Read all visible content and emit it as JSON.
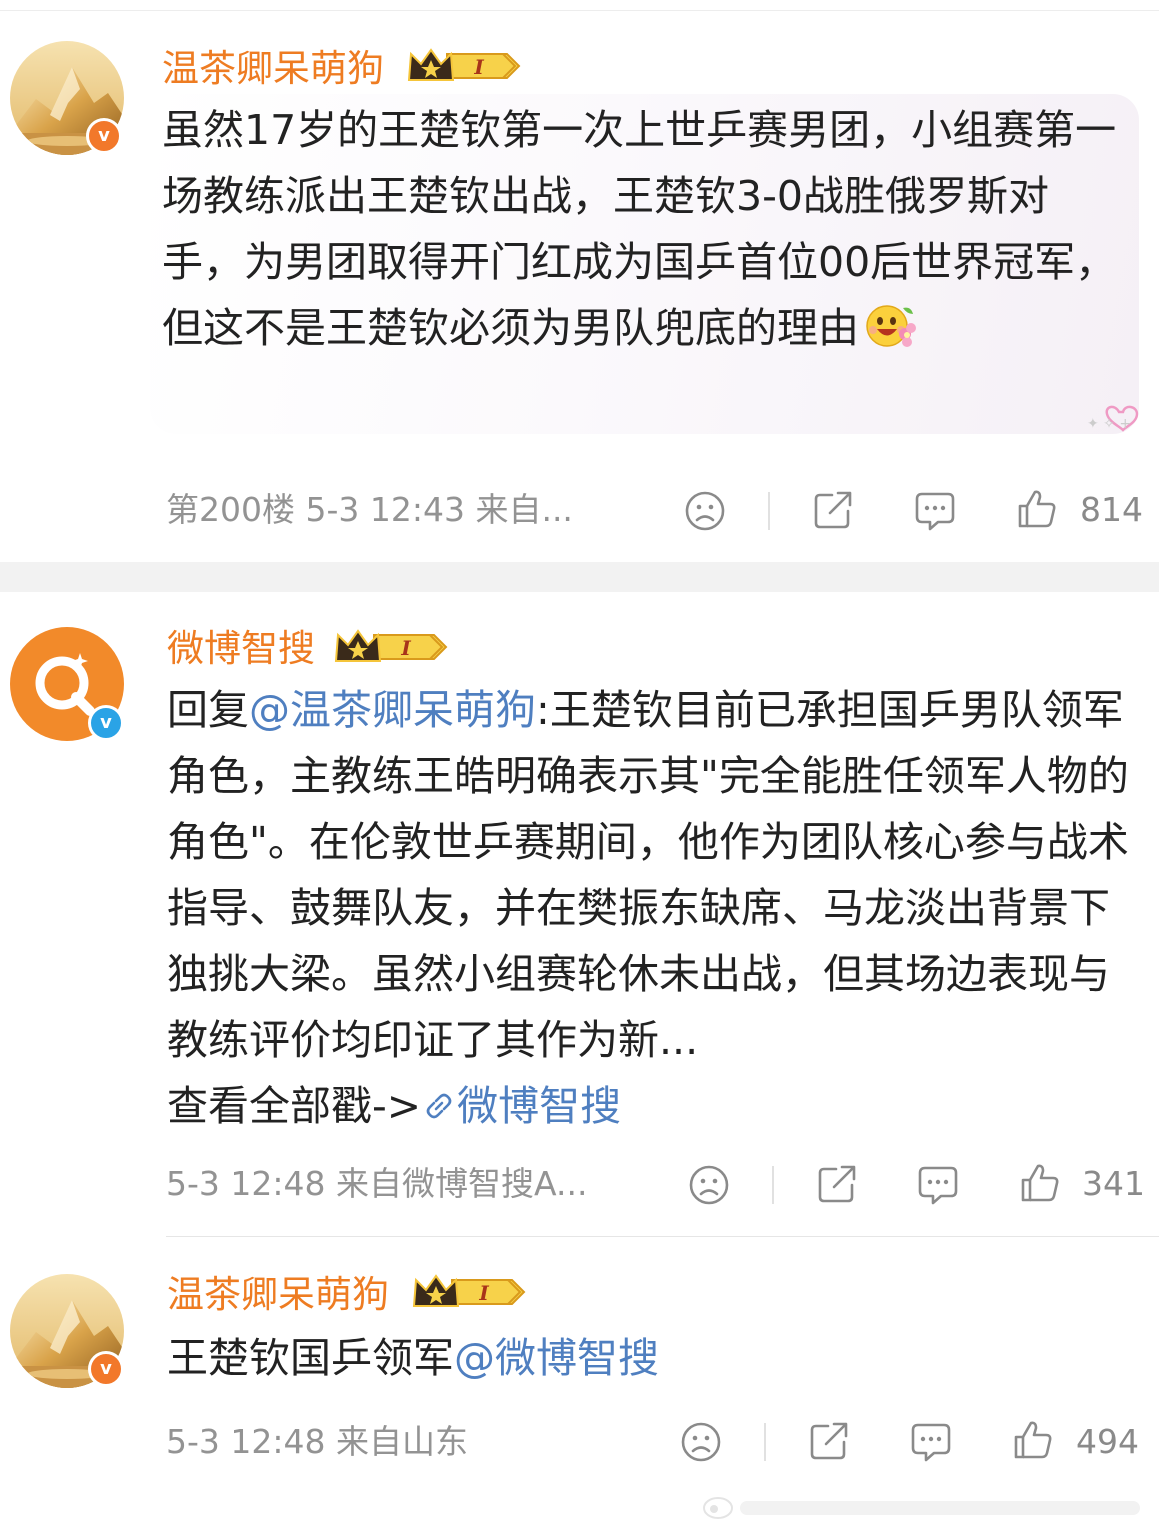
{
  "comments": [
    {
      "username": "温茶卿呆萌狗",
      "level": "I",
      "text": "虽然17岁的王楚钦第一次上世乒赛男团，小组赛第一场教练派出王楚钦出战，王楚钦3-0战胜俄罗斯对手，为男团取得开门红成为国乒首位00后世界冠军，但这不是王楚钦必须为男队兜底的理由",
      "meta": "第200楼  5-3 12:43  来自...",
      "likes": "814"
    },
    {
      "username": "微博智搜",
      "level": "I",
      "reply_prefix": "回复",
      "reply_mention": "@温茶卿呆萌狗",
      "reply_text": ":王楚钦目前已承担国乒男队领军角色，主教练王皓明确表示其\"完全能胜任领军人物的角色\"。在伦敦世乒赛期间，他作为团队核心参与战术指导、鼓舞队友，并在樊振东缺席、马龙淡出背景下独挑大梁。虽然小组赛轮休未出战，但其场边表现与教练评价均印证了其作为新...",
      "view_all": "查看全部戳->",
      "view_all_link": "微博智搜",
      "meta": "5-3 12:48  来自微博智搜A...",
      "likes": "341"
    },
    {
      "username": "温茶卿呆萌狗",
      "level": "I",
      "text": "王楚钦国乒领军",
      "mention": "@微博智搜",
      "meta": "5-3 12:48  来自山东",
      "likes": "494"
    }
  ],
  "icons": {
    "dislike": "frown-face-icon",
    "share": "share-icon",
    "comment": "comment-bubble-icon",
    "like": "thumbs-up-icon",
    "verified": "verified-v-badge",
    "crown": "crown-level-badge"
  },
  "colors": {
    "username": "#ee7c22",
    "link": "#4f7fc0",
    "meta": "#939393",
    "separator": "#f2f2f2"
  }
}
